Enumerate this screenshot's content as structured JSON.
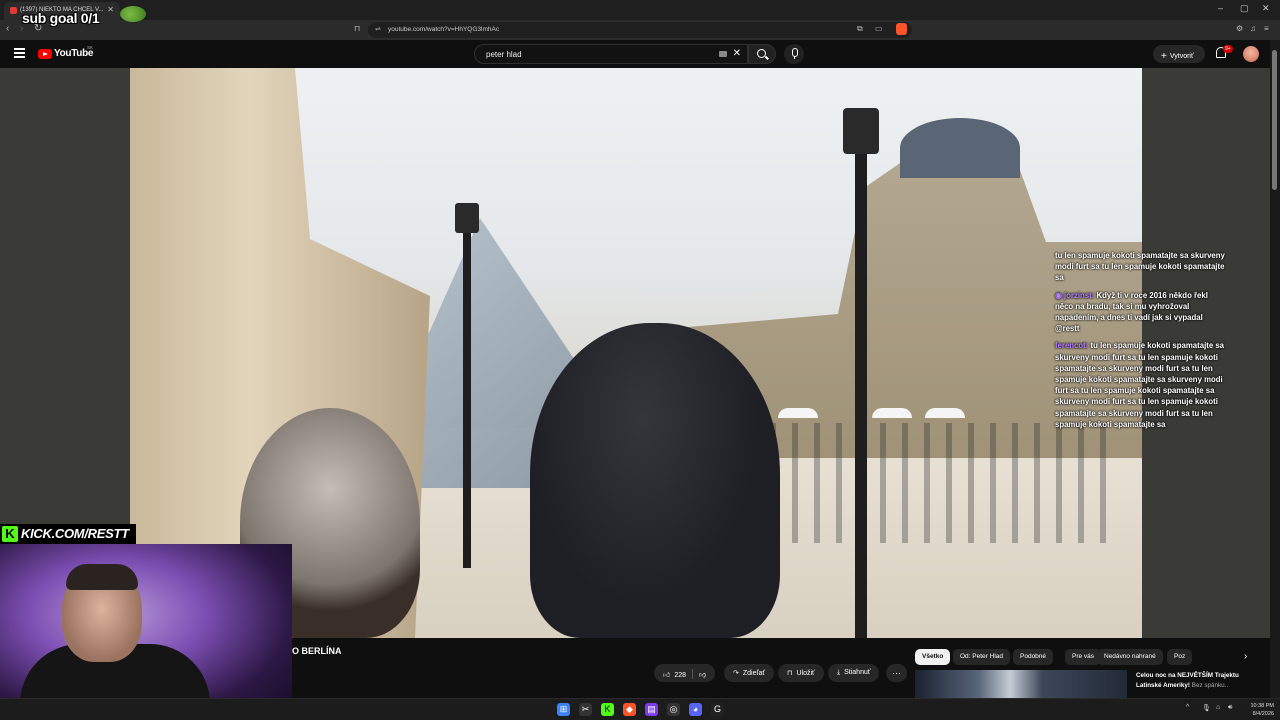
{
  "browser": {
    "tab_title": "(1397) NIEKTO MA CHCEL V...",
    "url": "youtube.com/watch?v=HhYQG3lmhAc",
    "window_controls": [
      "–",
      "▢",
      "✕"
    ]
  },
  "youtube": {
    "logo_text": "YouTube",
    "country_code": "SK",
    "search_value": "peter hlad",
    "create_label": "Vytvoriť",
    "notif_count": "9+"
  },
  "overlay": {
    "sub_goal": "sub goal 0/1",
    "kick_url": "KICK.COM/RESTT",
    "chat": [
      {
        "user": "",
        "text": "tu len spamuje kokoti spamatajte sa skurveny modi furt sa tu len spamuje kokoti spamatajte sa"
      },
      {
        "user": "jorzinst",
        "text": "Když ti v roce 2016 někdo řekl něco na bradu, tak si mu vyhrožoval napadením, a dnes ti vadí jak si vypadal @restt"
      },
      {
        "user": "ferencot",
        "text": "tu len spamuje kokoti spamatajte sa skurveny modi furt sa tu len spamuje kokoti spamatajte sa skurveny modi furt sa tu len spamuje kokoti spamatajte sa skurveny modi furt sa tu len spamuje kokoti spamatajte sa skurveny modi furt sa tu len spamuje kokoti spamatajte sa skurveny modi furt sa tu len spamuje kokoti spamatajte sa"
      }
    ]
  },
  "video": {
    "title": "O BERLÍNA",
    "likes": "228",
    "share_label": "Zdieľať",
    "save_label": "Uložiť",
    "download_label": "Stiahnuť",
    "more_label": "⋯"
  },
  "chips": [
    "Všetko",
    "Od: Peter Hlad",
    "Podobné",
    "Pre vás",
    "Nedávno nahrané",
    "Poz"
  ],
  "recommendation": {
    "title": "Celou noc na NEJVĚTŠÍM Trajektu Latinské Ameriky!",
    "suffix": "Bez spánku.."
  },
  "taskbar": {
    "time": "10:38 PM",
    "date": "8/4/2026"
  },
  "colors": {
    "youtube_red": "#ff0000",
    "kick_green": "#53fc18",
    "chat_user": "#b480ff"
  }
}
